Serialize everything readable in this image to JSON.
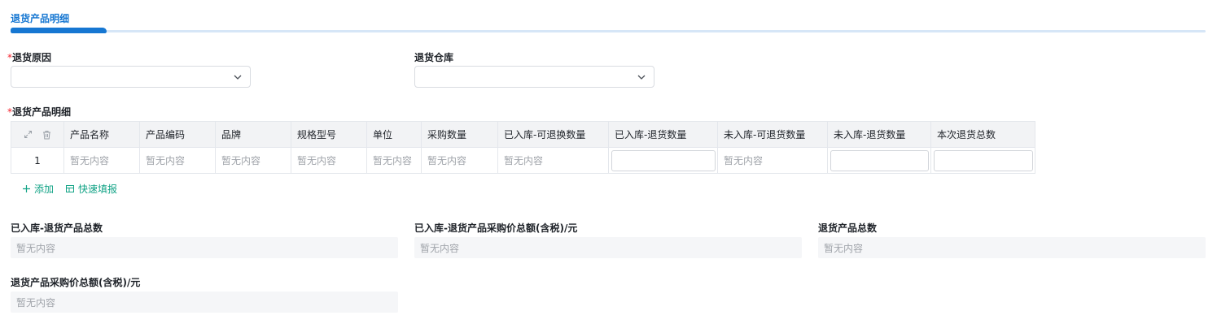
{
  "tab": {
    "title": "退货产品明细"
  },
  "form": {
    "reason": {
      "label": "退货原因",
      "value": ""
    },
    "warehouse": {
      "label": "退货仓库",
      "value": ""
    },
    "detail_label": "退货产品明细"
  },
  "table": {
    "columns": [
      "产品名称",
      "产品编码",
      "品牌",
      "规格型号",
      "单位",
      "采购数量",
      "已入库-可退换数量",
      "已入库-退货数量",
      "未入库-可退货数量",
      "未入库-退货数量",
      "本次退货总数"
    ],
    "rows": [
      {
        "index": "1",
        "product_name": "暂无内容",
        "product_code": "暂无内容",
        "brand": "暂无内容",
        "spec": "暂无内容",
        "unit": "暂无内容",
        "purchase_qty": "暂无内容",
        "stocked_returnable_qty": "暂无内容",
        "unstocked_returnable_qty": "暂无内容"
      }
    ]
  },
  "actions": {
    "add": "添加",
    "quick_fill": "快速填报"
  },
  "summary": {
    "stocked_total": {
      "label": "已入库-退货产品总数",
      "value": "暂无内容"
    },
    "stocked_amount": {
      "label": "已入库-退货产品采购价总额(含税)/元",
      "value": "暂无内容"
    },
    "total": {
      "label": "退货产品总数",
      "value": "暂无内容"
    },
    "amount": {
      "label": "退货产品采购价总额(含税)/元",
      "value": "暂无内容"
    }
  },
  "colors": {
    "accent": "#1677d2",
    "action": "#12a386",
    "required": "#f5222d"
  }
}
